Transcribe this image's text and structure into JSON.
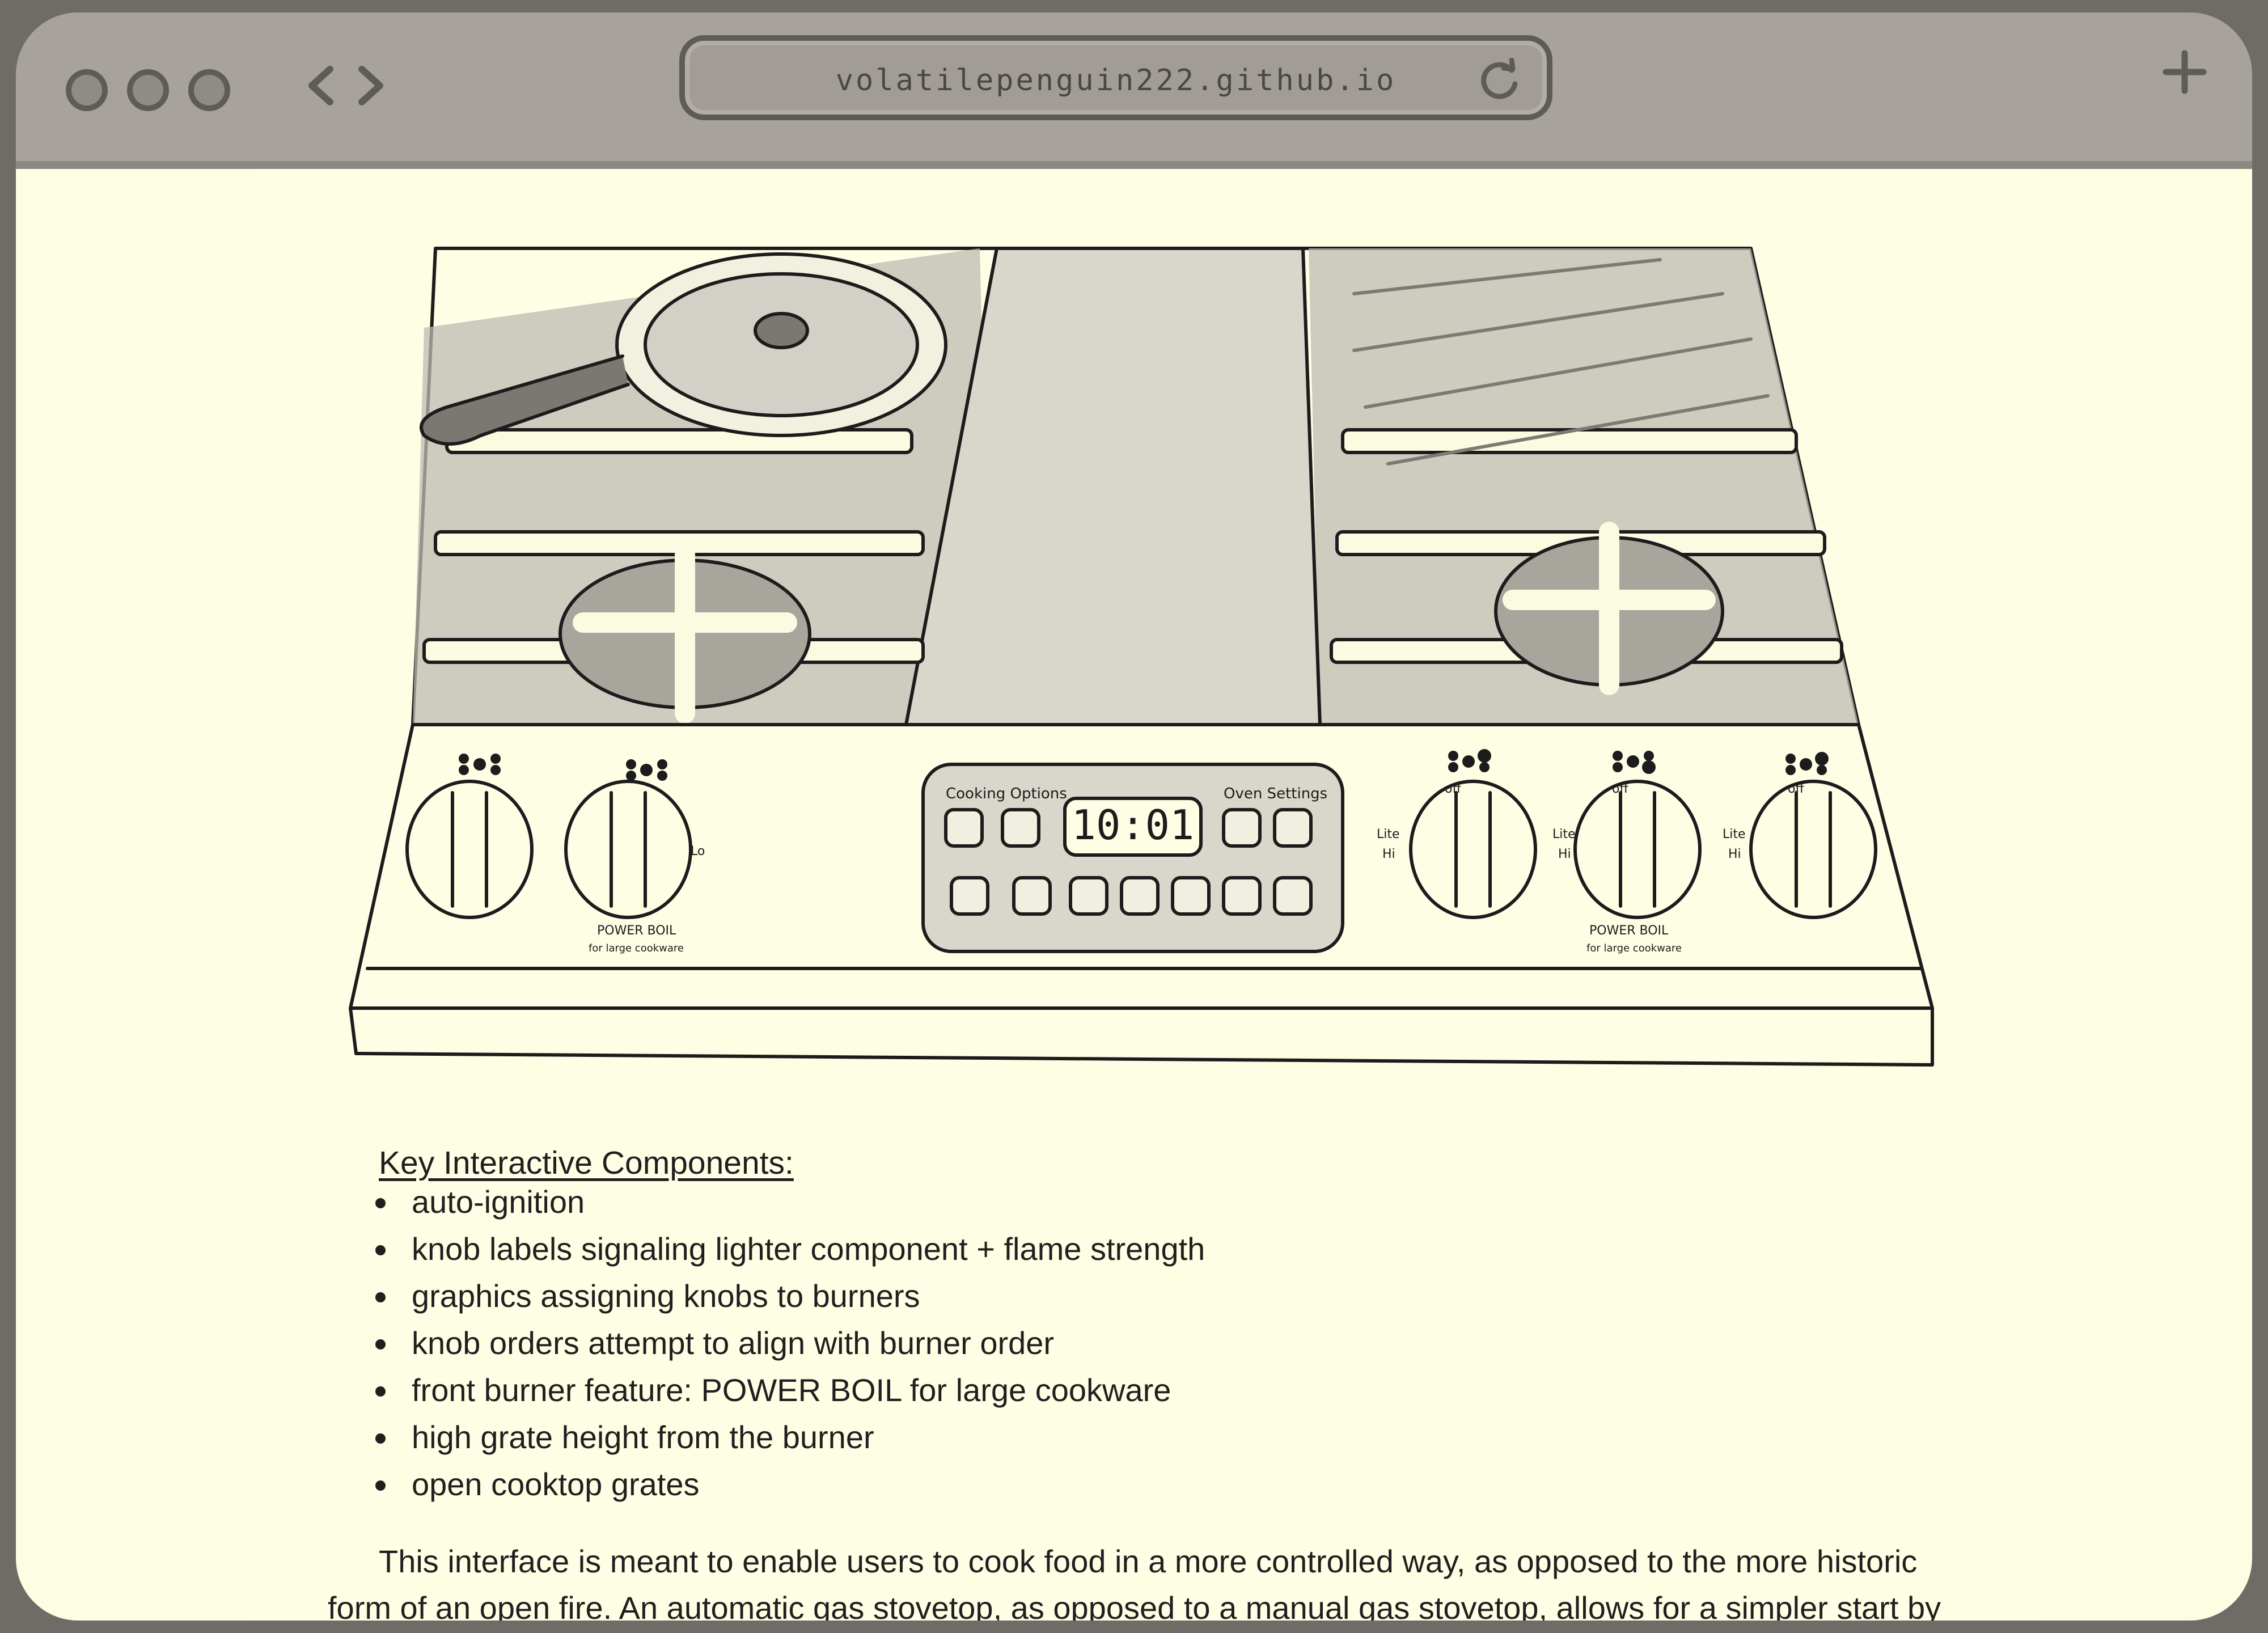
{
  "browser": {
    "url": "volatilepenguin222.github.io",
    "icons": [
      "close-dot-icon",
      "minimize-dot-icon",
      "maximize-dot-icon",
      "back-arrow-icon",
      "forward-arrow-icon",
      "reload-icon",
      "new-tab-plus-icon"
    ]
  },
  "sketch": {
    "display_time": "10:01",
    "panel_left_label": "Cooking Options",
    "panel_right_label": "Oven Settings",
    "power_boil_label": "POWER BOIL",
    "power_boil_sub": "for large cookware",
    "knob_off": "off",
    "knob_lite": "Lite",
    "knob_hi": "Hi",
    "knob_lo": "Lo"
  },
  "content": {
    "heading": "Key Interactive Components:",
    "features": [
      "auto-ignition",
      "knob labels signaling lighter component + flame strength",
      "graphics assigning knobs to burners",
      "knob orders attempt to align with burner order",
      "front burner feature: POWER BOIL for large cookware",
      "high grate height from the burner",
      "open cooktop grates"
    ],
    "paragraph": "This interface is meant to enable users to cook food in a more controlled way, as opposed to the more historic form of an open fire. An automatic gas stovetop, as opposed to a manual gas stovetop, allows for a simpler start by making"
  }
}
